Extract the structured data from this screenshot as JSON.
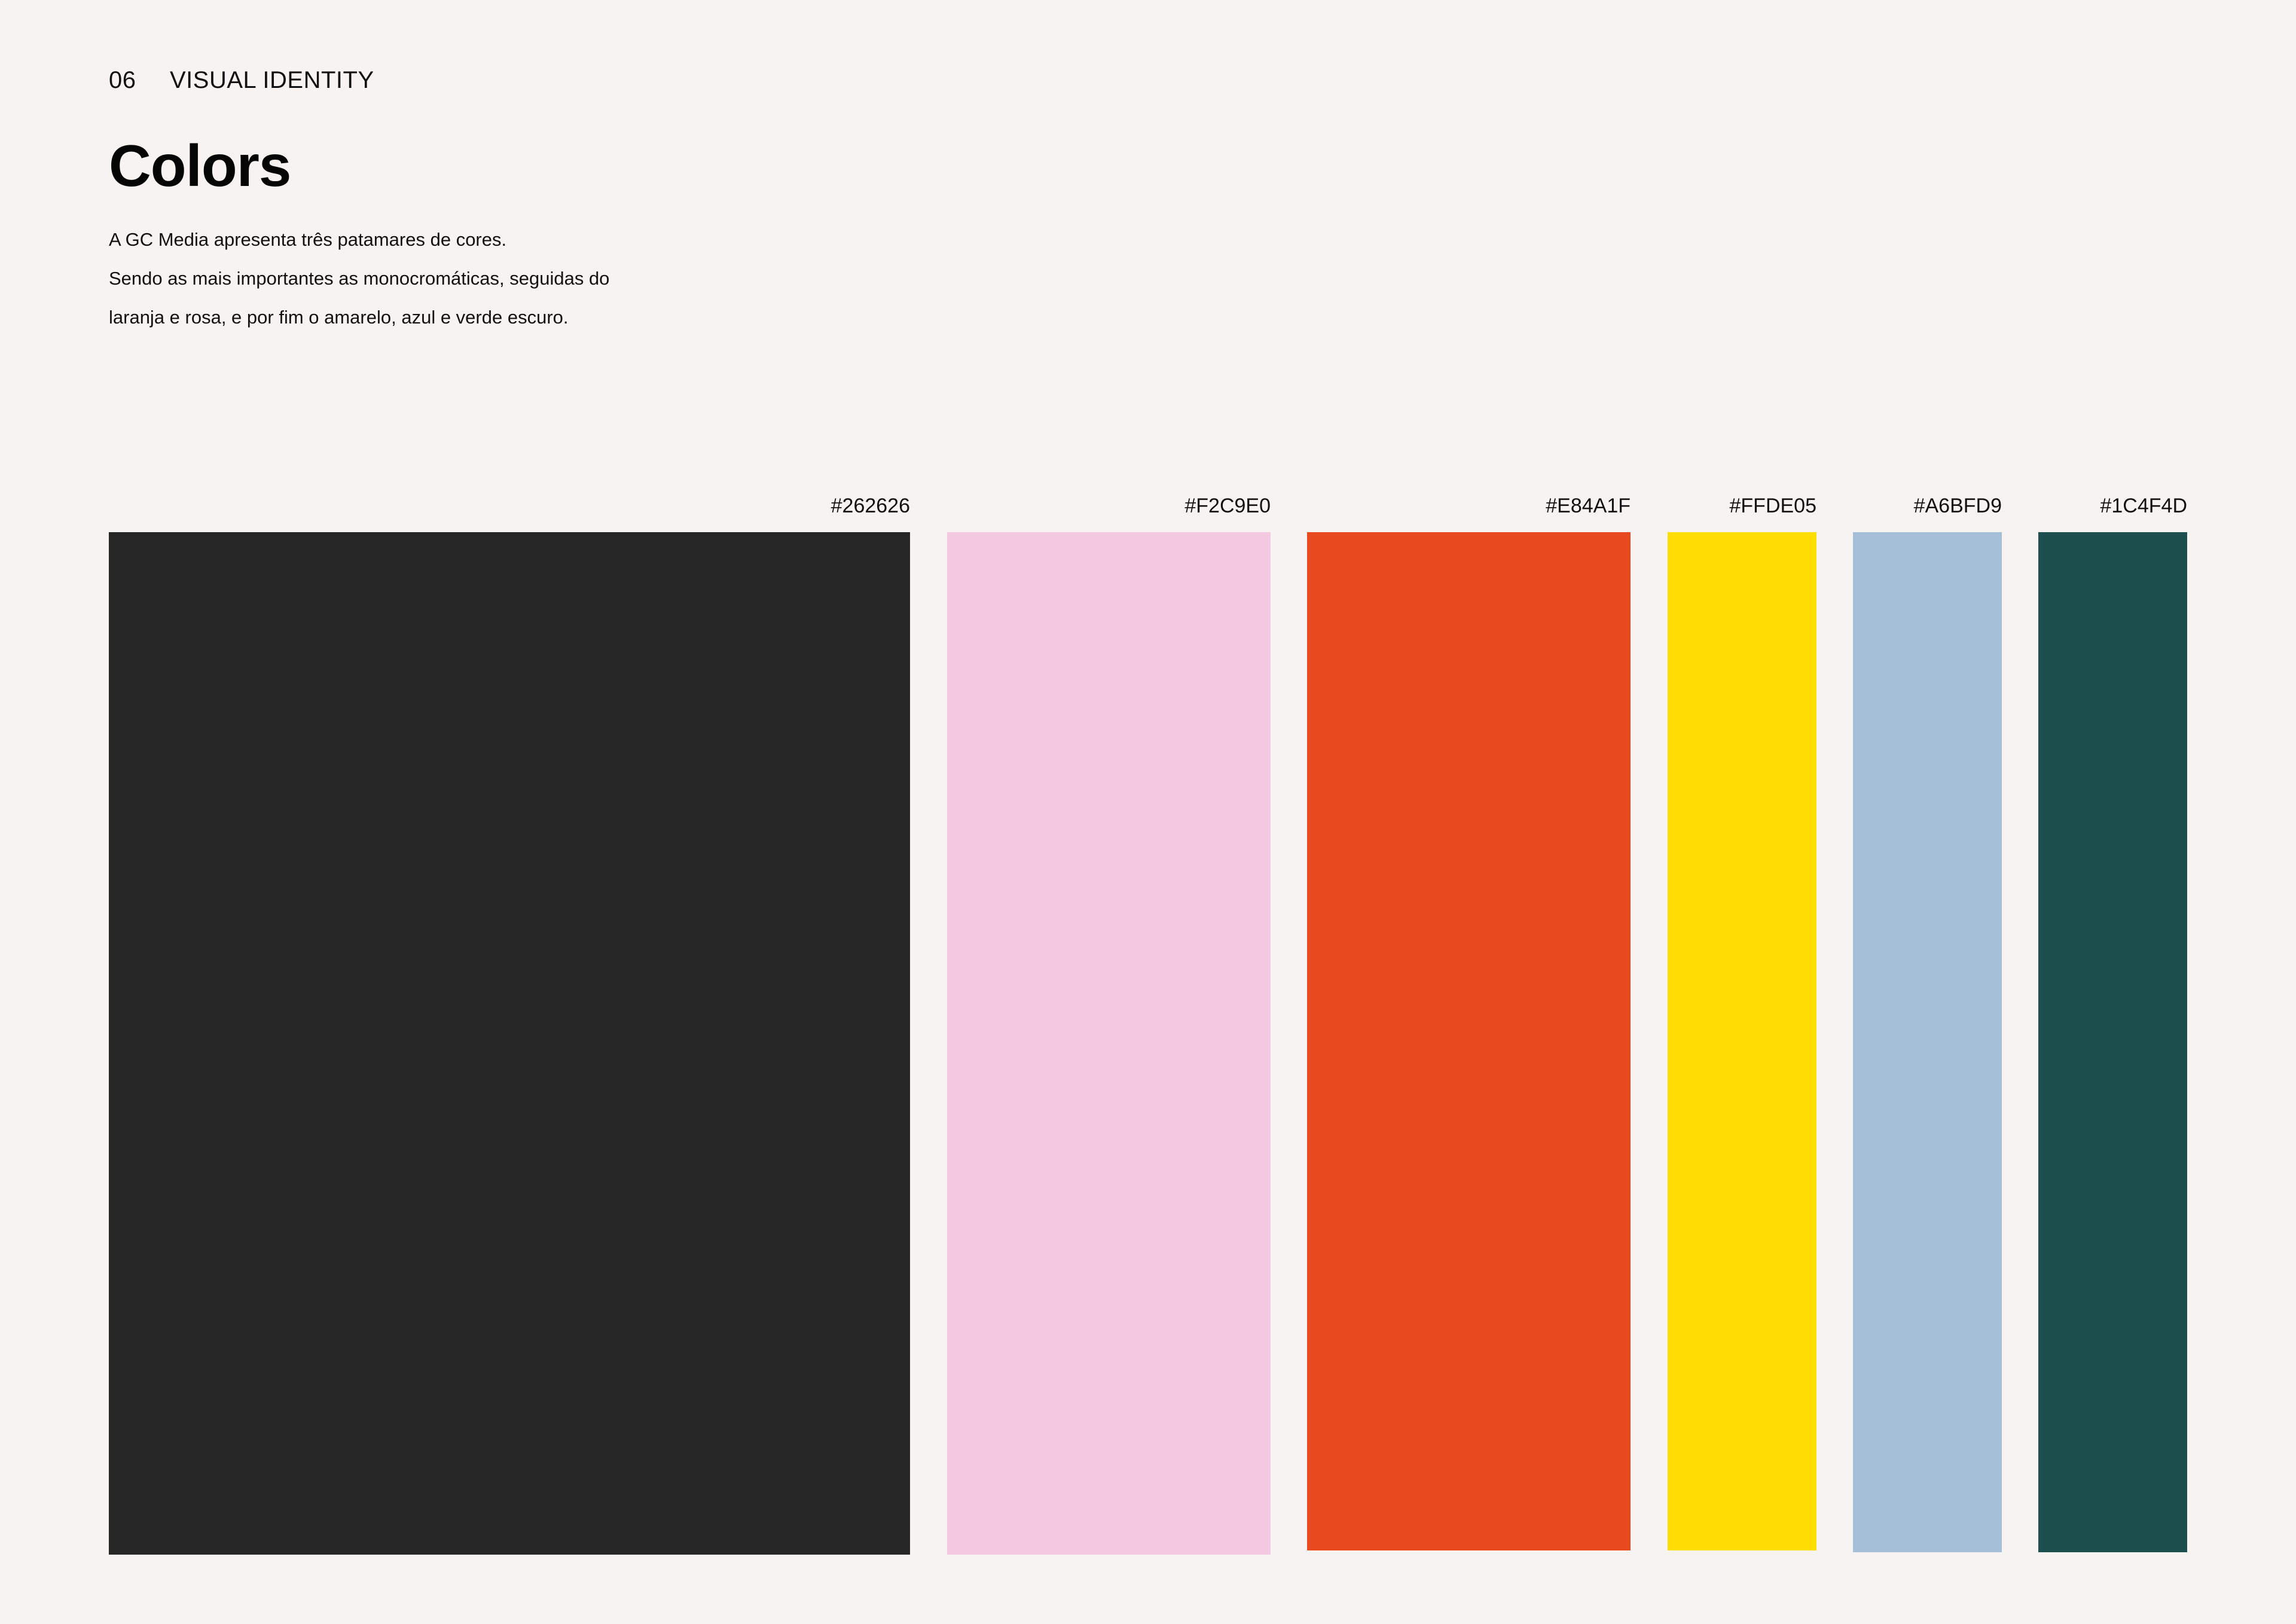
{
  "header": {
    "section_number": "06",
    "section_name": "VISUAL IDENTITY"
  },
  "title": "Colors",
  "description": [
    "A GC Media apresenta três patamares de cores.",
    "Sendo as mais importantes as monocromáticas, seguidas do",
    "laranja e rosa, e por fim o amarelo, azul e verde escuro."
  ],
  "colors": {
    "background": "#F6F3F0",
    "text": "#111111"
  },
  "swatches": [
    {
      "hex": "#262626",
      "color": "#262626"
    },
    {
      "hex": "#F2C9E0",
      "color": "#F2C9E0"
    },
    {
      "hex": "#E84A1F",
      "color": "#E84A1F"
    },
    {
      "hex": "#FFDE05",
      "color": "#FFDE05"
    },
    {
      "hex": "#A6BFD9",
      "color": "#A6BFD9"
    },
    {
      "hex": "#1C4F4D",
      "color": "#1C4F4D"
    }
  ]
}
